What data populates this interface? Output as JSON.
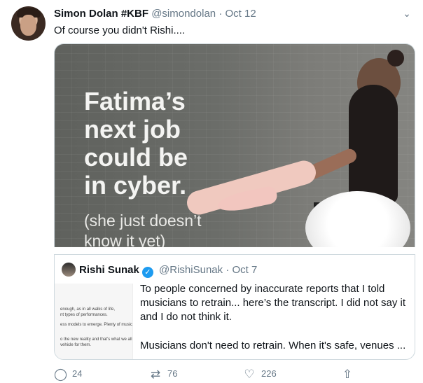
{
  "tweet": {
    "author_name": "Simon Dolan #KBF",
    "handle": "@simondolan",
    "separator": "·",
    "date": "Oct 12",
    "text": "Of course you didn't Rishi....",
    "menu_icon": "chevron-down-icon"
  },
  "media": {
    "headline_lines": [
      "Fatima’s",
      "next job",
      "could be",
      "in cyber."
    ],
    "subline_lines": [
      "(she just doesn’t",
      "know it yet)"
    ]
  },
  "quote": {
    "author_name": "Rishi Sunak",
    "handle": "@RishiSunak",
    "separator": "·",
    "date": "Oct 7",
    "thumbnail_lines": [
      "enough, as in all walks of life,",
      "nt types of performances.",
      "ess models to emerge. Plenty of music",
      "o the new reality and that's what we all",
      "vehicle for them."
    ],
    "paragraphs": [
      "To people concerned by inaccurate reports that I told musicians to retrain... here’s the transcript. I did not say it and I do not think it.",
      "Musicians don't need to retrain. When it's safe, venues ..."
    ]
  },
  "actions": {
    "reply_count": "24",
    "retweet_count": "76",
    "like_count": "226",
    "icons": [
      "reply-icon",
      "retweet-icon",
      "like-icon",
      "share-icon"
    ]
  },
  "colors": {
    "text": "#0f1419",
    "secondary": "#657786",
    "verified": "#1d9bf0",
    "border": "#cfd9de"
  }
}
